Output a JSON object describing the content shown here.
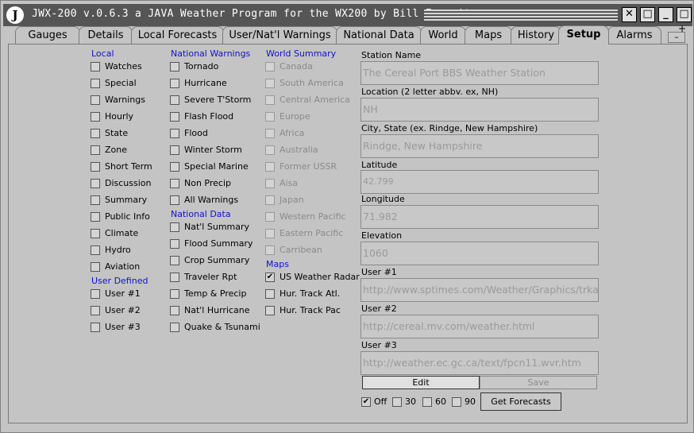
{
  "window": {
    "title": "JWX-200 v.0.6.3    a JAVA Weather Program for the WX200 by Bill Esposito",
    "logo": "J",
    "close": "✕",
    "maximize": "□",
    "minimize": "_",
    "restore": "□"
  },
  "tabs": [
    {
      "label": "Gauges"
    },
    {
      "label": "Details"
    },
    {
      "label": "Local Forecasts"
    },
    {
      "label": "User/Nat'l Warnings"
    },
    {
      "label": "National Data"
    },
    {
      "label": "World"
    },
    {
      "label": "Maps"
    },
    {
      "label": "History"
    },
    {
      "label": "Setup"
    },
    {
      "label": "Alarms"
    }
  ],
  "tab_scroll": {
    "minus": "–",
    "plus": "+"
  },
  "local": {
    "header": "Local",
    "items": [
      "Watches",
      "Special",
      "Warnings",
      "Hourly",
      "State",
      "Zone",
      "Short Term",
      "Discussion",
      "Summary",
      "Public Info",
      "Climate",
      "Hydro",
      "Aviation"
    ]
  },
  "user_defined": {
    "header": "User Defined",
    "items": [
      "User #1",
      "User #2",
      "User #3"
    ]
  },
  "national_warnings": {
    "header": "National Warnings",
    "items": [
      "Tornado",
      "Hurricane",
      "Severe T'Storm",
      "Flash Flood",
      "Flood",
      "Winter Storm",
      "Special Marine",
      "Non Precip",
      "All Warnings"
    ]
  },
  "national_data": {
    "header": "National Data",
    "items": [
      "Nat'l Summary",
      "Flood Summary",
      "Crop Summary",
      "Traveler Rpt",
      "Temp & Precip",
      "Nat'l Hurricane",
      "Quake & Tsunami"
    ]
  },
  "world_summary": {
    "header": "World Summary",
    "items": [
      "Canada",
      "South America",
      "Central America",
      "Europe",
      "Africa",
      "Australia",
      "Former USSR",
      "Aisa",
      "Japan",
      "Western Pacific",
      "Eastern Pacific",
      "Carribean"
    ]
  },
  "maps": {
    "header": "Maps",
    "items": [
      {
        "label": "US Weather Radar",
        "checked": true
      },
      {
        "label": "Hur. Track Atl.",
        "checked": false
      },
      {
        "label": "Hur. Track Pac",
        "checked": false
      }
    ]
  },
  "fields": [
    {
      "label": "Station Name",
      "value": "The Cereal Port BBS Weather Station"
    },
    {
      "label": "Location (2 letter abbv. ex, NH)",
      "value": "NH"
    },
    {
      "label": "City, State (ex. Rindge, New Hampshire)",
      "value": "Rindge, New Hampshire"
    },
    {
      "label": "Latitude",
      "value": "42.799"
    },
    {
      "label": "Longitude",
      "value": "71.982"
    },
    {
      "label": "Elevation",
      "value": "1060"
    },
    {
      "label": "User #1",
      "value": "http://www.sptimes.com/Weather/Graphics/trkatlus"
    },
    {
      "label": "User #2",
      "value": "http://cereal.mv.com/weather.html"
    },
    {
      "label": "User #3",
      "value": "http://weather.ec.gc.ca/text/fpcn11.wvr.htm"
    }
  ],
  "buttons": {
    "edit": "Edit",
    "save": "Save",
    "get_forecasts": "Get Forecasts"
  },
  "intervals": [
    {
      "label": "Off",
      "checked": true
    },
    {
      "label": "30",
      "checked": false
    },
    {
      "label": "60",
      "checked": false
    },
    {
      "label": "90",
      "checked": false
    }
  ],
  "check_mark": "✔",
  "colors": {
    "header_blue": "#1010d0",
    "titlebar": "#555555",
    "disabled_text": "#8a8a8a"
  }
}
